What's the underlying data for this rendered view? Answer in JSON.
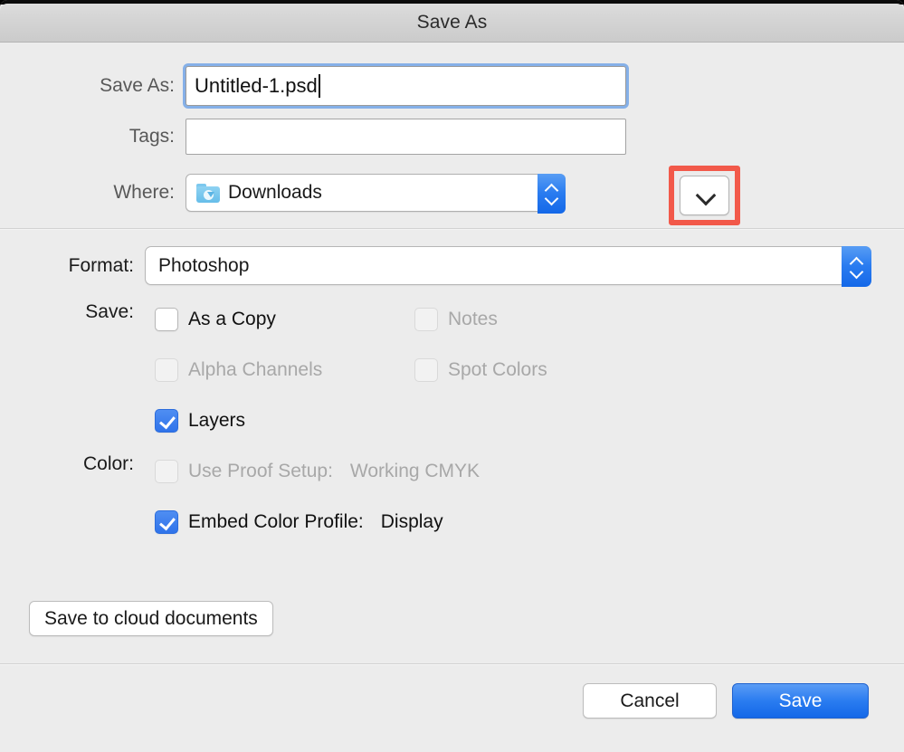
{
  "window": {
    "title": "Save As"
  },
  "fields": {
    "save_as": {
      "label": "Save As:",
      "value": "Untitled-1.psd",
      "placeholder": ""
    },
    "tags": {
      "label": "Tags:",
      "value": "",
      "placeholder": ""
    },
    "where": {
      "label": "Where:",
      "value": "Downloads",
      "icon": "downloads-folder-icon",
      "expand_icon": "chevron-down-icon",
      "stepper_icon": "up-down-chevrons-icon"
    }
  },
  "format": {
    "label": "Format:",
    "value": "Photoshop",
    "stepper_icon": "up-down-chevrons-icon"
  },
  "save_section": {
    "label": "Save:",
    "options": [
      {
        "label": "As a Copy",
        "checked": false,
        "disabled": false
      },
      {
        "label": "Notes",
        "checked": false,
        "disabled": true
      },
      {
        "label": "Alpha Channels",
        "checked": false,
        "disabled": true
      },
      {
        "label": "Spot Colors",
        "checked": false,
        "disabled": true
      },
      {
        "label": "Layers",
        "checked": true,
        "disabled": false
      }
    ]
  },
  "color_section": {
    "label": "Color:",
    "options": [
      {
        "label": "Use Proof Setup:",
        "value": "Working CMYK",
        "checked": false,
        "disabled": true
      },
      {
        "label": "Embed Color Profile:",
        "value": "Display",
        "checked": true,
        "disabled": false
      }
    ]
  },
  "buttons": {
    "cloud": "Save to cloud documents",
    "cancel": "Cancel",
    "save": "Save"
  },
  "annotation": {
    "highlight_color": "#f2594a",
    "target": "where-expand-button"
  },
  "colors": {
    "accent": "#2a7cf0",
    "background": "#ececec",
    "titlebar": "#d3d3d3",
    "focus_ring": "#85b0e8"
  }
}
